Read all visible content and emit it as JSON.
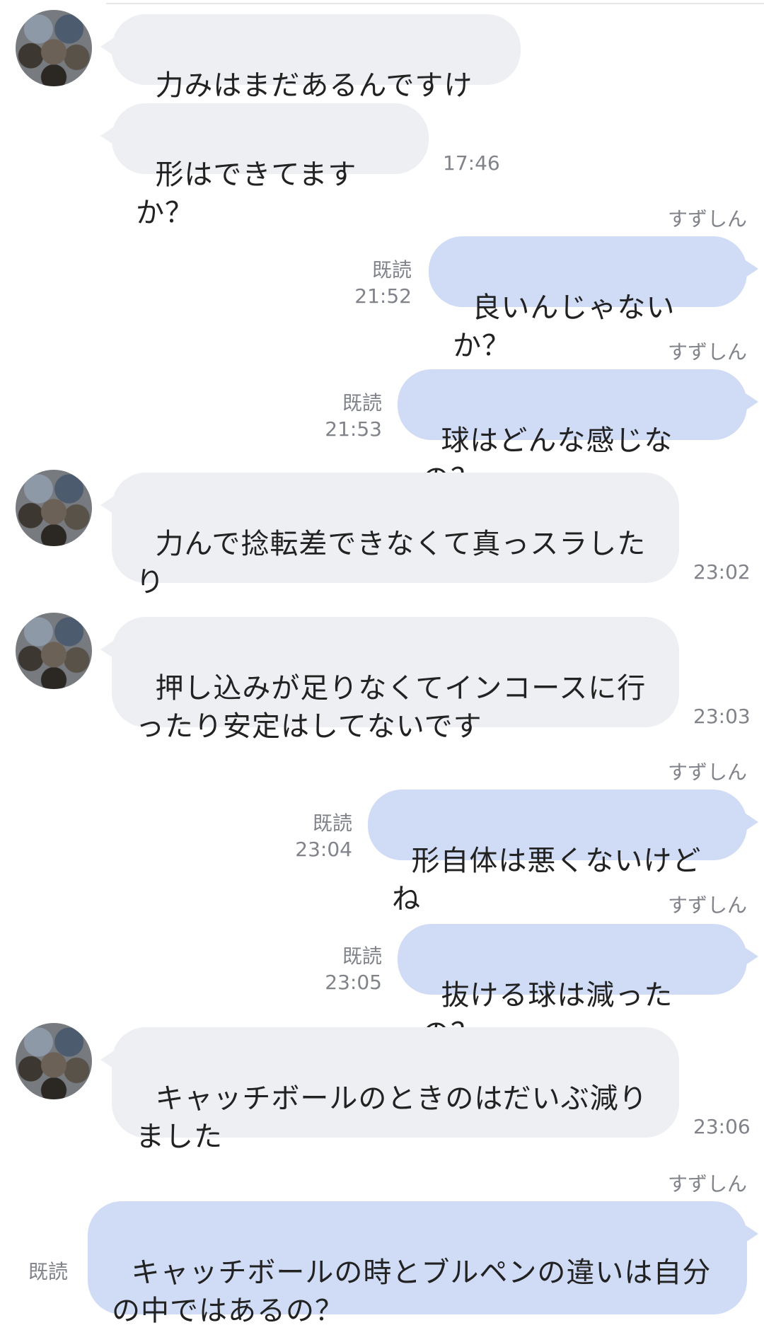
{
  "chat": {
    "sender_name": "すずしん",
    "read_label": "既読",
    "messages": [
      {
        "text": "力みはまだあるんですけど"
      },
      {
        "text": "形はできてますか？",
        "time": "17:46"
      },
      {
        "text": "良いんじゃないか？",
        "time": "21:52"
      },
      {
        "text": "球はどんな感じなの？",
        "time": "21:53"
      },
      {
        "text": "力んで捻転差できなくて真っスラした\nり",
        "time": "23:02"
      },
      {
        "text": "押し込みが足りなくてインコースに行\nったり安定はしてないです",
        "time": "23:03"
      },
      {
        "text": "形自体は悪くないけどね",
        "time": "23:04"
      },
      {
        "text": "抜ける球は減ったの？",
        "time": "23:05"
      },
      {
        "text": "キャッチボールのときのはだいぶ減り\nました",
        "time": "23:06"
      },
      {
        "text": "キャッチボールの時とブルペンの違いは自分\nの中ではあるの？"
      }
    ]
  }
}
